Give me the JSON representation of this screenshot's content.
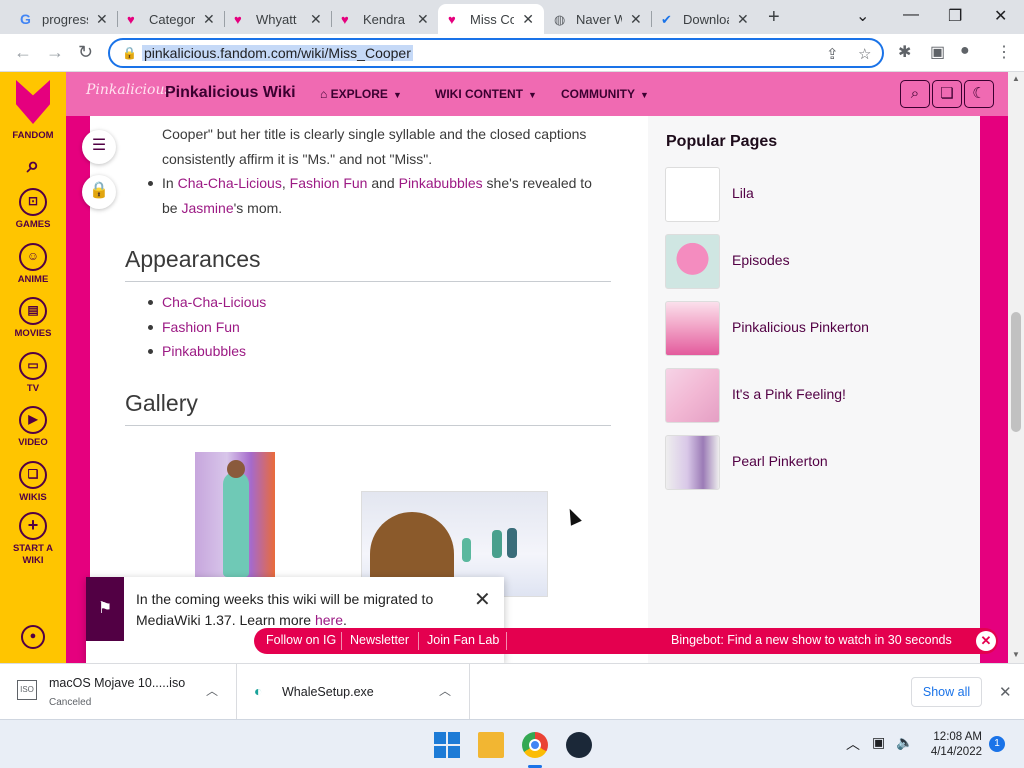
{
  "browser": {
    "tabs": [
      {
        "title": "progress"
      },
      {
        "title": "Category"
      },
      {
        "title": "Whyatt"
      },
      {
        "title": "Kendra"
      },
      {
        "title": "Miss Cooper"
      },
      {
        "title": "Naver W"
      },
      {
        "title": "Download"
      }
    ],
    "url": "pinkalicious.fandom.com/wiki/Miss_Cooper"
  },
  "fandom_sidebar": {
    "brand": "FANDOM",
    "items": [
      "GAMES",
      "ANIME",
      "MOVIES",
      "TV",
      "VIDEO",
      "WIKIS",
      "START A WIKI"
    ]
  },
  "wiki_header": {
    "logo": "Pinkalicious",
    "name": "Pinkalicious Wiki",
    "nav": [
      "EXPLORE",
      "WIKI CONTENT",
      "COMMUNITY"
    ]
  },
  "article": {
    "para1_line1": "Cooper\" but her title is clearly single syllable and the closed captions",
    "para1_line2": "consistently affirm it is \"Ms.\" and not \"Miss\".",
    "bullet": {
      "pre": "In ",
      "link1": "Cha-Cha-Licious",
      "sep1": ", ",
      "link2": "Fashion Fun",
      "sep2": " and ",
      "link3": "Pinkabubbles",
      "post": " she's revealed to",
      "line2_pre": "be ",
      "link4": "Jasmine",
      "line2_post": "'s mom."
    },
    "appearances_heading": "Appearances",
    "appearances": [
      "Cha-Cha-Licious",
      "Fashion Fun",
      "Pinkabubbles"
    ],
    "gallery_heading": "Gallery"
  },
  "rail": {
    "title": "Popular Pages",
    "pages": [
      "Lila",
      "Episodes",
      "Pinkalicious Pinkerton",
      "It's a Pink Feeling!",
      "Pearl Pinkerton"
    ]
  },
  "notification": {
    "text_pre": "In the coming weeks this wiki will be migrated to MediaWiki 1.37. Learn more ",
    "link": "here",
    "text_post": "."
  },
  "bottom_bar": {
    "links": [
      "Follow on IG",
      "Newsletter",
      "Join Fan Lab"
    ],
    "bingebot": "Bingebot: Find a new show to watch in 30 seconds"
  },
  "downloads": {
    "items": [
      {
        "name": "macOS Mojave 10.....iso",
        "status": "Canceled"
      },
      {
        "name": "WhaleSetup.exe",
        "status": ""
      }
    ],
    "show_all": "Show all"
  },
  "taskbar": {
    "time": "12:08 AM",
    "date": "4/14/2022",
    "notification_count": "1"
  },
  "colors": {
    "fandom_yellow": "#ffc500",
    "wiki_pink": "#f06ab2",
    "side_magenta": "#e5007e",
    "link": "#9c1a84",
    "bingebar": "#e4004f"
  }
}
